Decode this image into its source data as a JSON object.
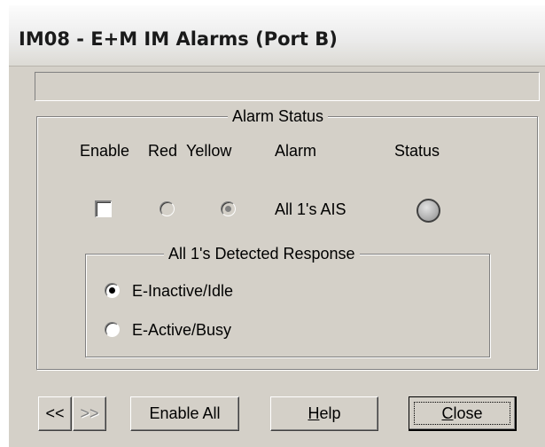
{
  "window": {
    "title": "IM08 - E+M IM Alarms (Port B)",
    "status_text": ""
  },
  "alarm_status": {
    "legend": "Alarm Status",
    "headers": {
      "enable": "Enable",
      "red": "Red",
      "yellow": "Yellow",
      "alarm": "Alarm",
      "status": "Status"
    },
    "row": {
      "enabled": false,
      "red_selected": false,
      "yellow_selected": true,
      "alarm_name": "All 1's AIS",
      "status_indicator": "off",
      "status_color": "#b0b0b0"
    }
  },
  "response": {
    "legend": "All 1's Detected Response",
    "options": [
      {
        "label": "E-Inactive/Idle",
        "selected": true
      },
      {
        "label": "E-Active/Busy",
        "selected": false
      }
    ]
  },
  "buttons": {
    "prev": "<<",
    "next": ">>",
    "enable_all": "Enable All",
    "help_mnemonic": "H",
    "help_rest": "elp",
    "close_mnemonic": "C",
    "close_rest": "lose"
  }
}
